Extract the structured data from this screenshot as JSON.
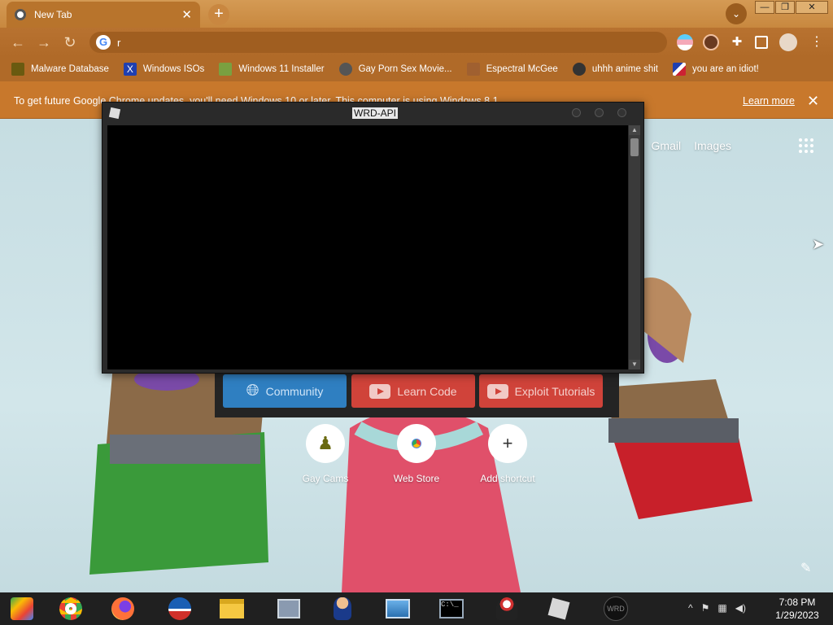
{
  "browser": {
    "tab": {
      "title": "New Tab"
    },
    "omnibox": {
      "value": "r"
    }
  },
  "bookmarks": [
    {
      "label": "Malware Database",
      "icon": "folder-icon",
      "color": "#6a5a10"
    },
    {
      "label": "Windows ISOs",
      "icon": "x-icon",
      "color": "#1f3fb0"
    },
    {
      "label": "Windows 11 Installer",
      "icon": "image-icon",
      "color": "#7aa040"
    },
    {
      "label": "Gay Porn Sex Movie...",
      "icon": "gear-icon",
      "color": "#555555"
    },
    {
      "label": "Espectral McGee",
      "icon": "avatar-icon",
      "color": "#a06030"
    },
    {
      "label": "uhhh anime shit",
      "icon": "anime-icon",
      "color": "#333333"
    },
    {
      "label": "you are an idiot!",
      "icon": "flag-icon",
      "color": "#cc2233"
    }
  ],
  "infobar": {
    "message": "To get future Google Chrome updates, you'll need Windows 10 or later. This computer is using Windows 8.1.",
    "learn_more": "Learn more"
  },
  "ntp": {
    "links": [
      "Gmail",
      "Images"
    ],
    "shortcuts": [
      {
        "label": "Gay Cams",
        "icon": "user-icon"
      },
      {
        "label": "Web Store",
        "icon": "chrome-icon"
      },
      {
        "label": "Add shortcut",
        "icon": "plus-icon"
      }
    ]
  },
  "wrd_window": {
    "title": "WRD-API",
    "buttons": [
      "Community",
      "Learn Code",
      "Exploit Tutorials"
    ]
  },
  "taskbar": {
    "apps": [
      "chrome-cube-icon",
      "chrome-icon",
      "firefox-icon",
      "obama-icon",
      "file-explorer-icon",
      "task-manager-icon",
      "agent-icon",
      "photos-icon",
      "cmd-icon",
      "java-icon",
      "roblox-icon",
      "wrd-icon"
    ],
    "time": "7:08 PM",
    "date": "1/29/2023"
  },
  "colors": {
    "accent": "#b06a28",
    "wrd_blue": "#2f7fc1",
    "wrd_red": "#d0433a"
  }
}
